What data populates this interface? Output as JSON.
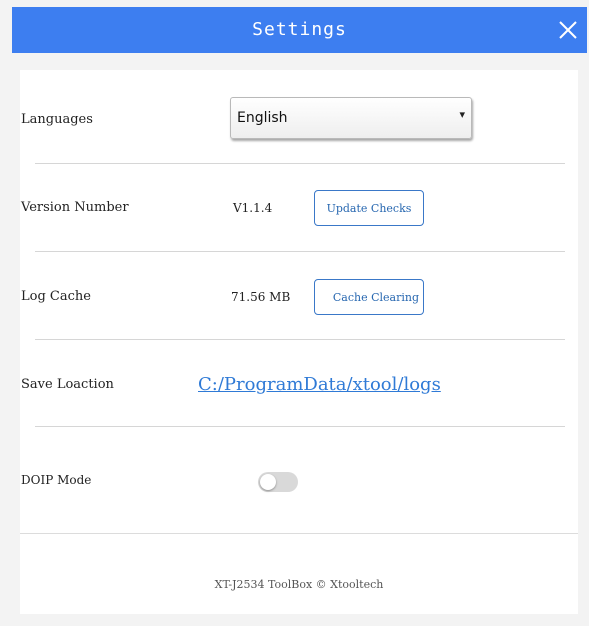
{
  "window": {
    "title": "Settings",
    "close_icon": "close-x-icon",
    "accent_color": "#3d7ef0"
  },
  "settings": {
    "language": {
      "label": "Languages",
      "selected": "English"
    },
    "version": {
      "label": "Version Number",
      "value": "V1.1.4",
      "button_label": "Update Checks"
    },
    "log_cache": {
      "label": "Log Cache",
      "value": "71.56 MB",
      "button_label": "Cache Clearing"
    },
    "save_location": {
      "label": "Save Loaction",
      "path": "C:/ProgramData/xtool/logs"
    },
    "doip_mode": {
      "label": "DOIP Mode",
      "enabled": false
    }
  },
  "footer": {
    "text": "XT-J2534 ToolBox © Xtooltech"
  }
}
